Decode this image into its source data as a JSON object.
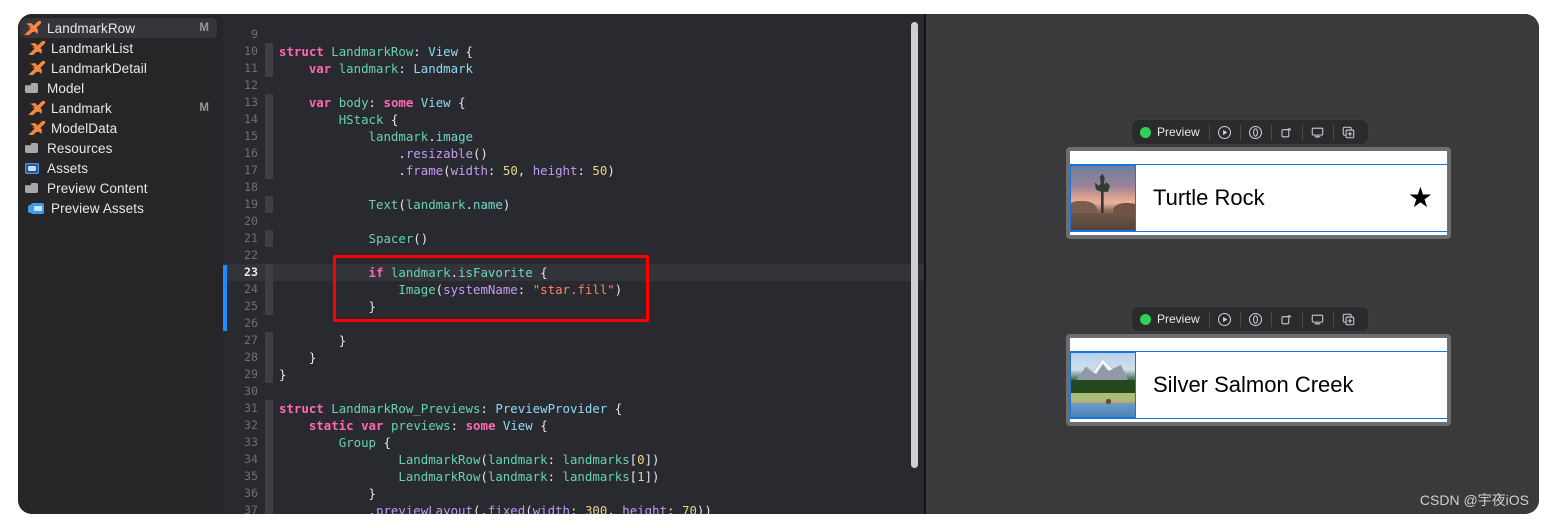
{
  "sidebar": {
    "items": [
      {
        "label": "LandmarkRow",
        "icon": "swift-file-icon",
        "badge": "M",
        "selected": true,
        "indent": 1
      },
      {
        "label": "LandmarkList",
        "icon": "swift-file-icon",
        "badge": "",
        "selected": false,
        "indent": 1
      },
      {
        "label": "LandmarkDetail",
        "icon": "swift-file-icon",
        "badge": "",
        "selected": false,
        "indent": 1
      },
      {
        "label": "Model",
        "icon": "folder-icon",
        "badge": "",
        "selected": false,
        "indent": 0
      },
      {
        "label": "Landmark",
        "icon": "swift-file-icon",
        "badge": "M",
        "selected": false,
        "indent": 1
      },
      {
        "label": "ModelData",
        "icon": "swift-file-icon",
        "badge": "",
        "selected": false,
        "indent": 1
      },
      {
        "label": "Resources",
        "icon": "folder-icon",
        "badge": "",
        "selected": false,
        "indent": 0
      },
      {
        "label": "Assets",
        "icon": "asset-catalog-icon",
        "badge": "",
        "selected": false,
        "indent": 0
      },
      {
        "label": "Preview Content",
        "icon": "folder-icon",
        "badge": "",
        "selected": false,
        "indent": 0
      },
      {
        "label": "Preview Assets",
        "icon": "preview-assets-icon",
        "badge": "",
        "selected": false,
        "indent": 1
      }
    ]
  },
  "editor": {
    "current_line": 23,
    "change_bar_lines": [
      23,
      24,
      25,
      26
    ],
    "annotation_color": "#ff0000",
    "lines": [
      {
        "n": "9",
        "text": ""
      },
      {
        "n": "10",
        "text": "struct LandmarkRow: View {"
      },
      {
        "n": "11",
        "text": "    var landmark: Landmark"
      },
      {
        "n": "12",
        "text": ""
      },
      {
        "n": "13",
        "text": "    var body: some View {"
      },
      {
        "n": "14",
        "text": "        HStack {"
      },
      {
        "n": "15",
        "text": "            landmark.image"
      },
      {
        "n": "16",
        "text": "                .resizable()"
      },
      {
        "n": "17",
        "text": "                .frame(width: 50, height: 50)"
      },
      {
        "n": "18",
        "text": ""
      },
      {
        "n": "19",
        "text": "            Text(landmark.name)"
      },
      {
        "n": "20",
        "text": ""
      },
      {
        "n": "21",
        "text": "            Spacer()"
      },
      {
        "n": "22",
        "text": ""
      },
      {
        "n": "23",
        "text": "            if landmark.isFavorite {"
      },
      {
        "n": "24",
        "text": "                Image(systemName: \"star.fill\")"
      },
      {
        "n": "25",
        "text": "            }"
      },
      {
        "n": "26",
        "text": ""
      },
      {
        "n": "27",
        "text": "        }"
      },
      {
        "n": "28",
        "text": "    }"
      },
      {
        "n": "29",
        "text": "}"
      },
      {
        "n": "30",
        "text": ""
      },
      {
        "n": "31",
        "text": "struct LandmarkRow_Previews: PreviewProvider {"
      },
      {
        "n": "32",
        "text": "    static var previews: some View {"
      },
      {
        "n": "33",
        "text": "        Group {"
      },
      {
        "n": "34",
        "text": "                LandmarkRow(landmark: landmarks[0])"
      },
      {
        "n": "35",
        "text": "                LandmarkRow(landmark: landmarks[1])"
      },
      {
        "n": "36",
        "text": "            }"
      },
      {
        "n": "37",
        "text": "            .previewLayout(.fixed(width: 300, height: 70))"
      }
    ]
  },
  "preview": {
    "toolbar_label": "Preview",
    "status_color": "#2fd157",
    "buttons": [
      {
        "name": "live-preview-icon",
        "title": "Live Preview"
      },
      {
        "name": "inspect-preview-icon",
        "title": "Inspect Preview"
      },
      {
        "name": "rotate-device-icon",
        "title": "Rotate"
      },
      {
        "name": "preview-on-device-icon",
        "title": "Preview on Device"
      },
      {
        "name": "duplicate-preview-icon",
        "title": "Duplicate Preview"
      }
    ],
    "cards": [
      {
        "title": "Turtle Rock",
        "thumb": "desert-joshua-tree-thumbnail",
        "favorite": true,
        "star": "★"
      },
      {
        "title": "Silver Salmon Creek",
        "thumb": "mountain-lake-thumbnail",
        "favorite": false,
        "star": ""
      }
    ]
  },
  "watermark": {
    "text": "CSDN @宇夜iOS"
  }
}
